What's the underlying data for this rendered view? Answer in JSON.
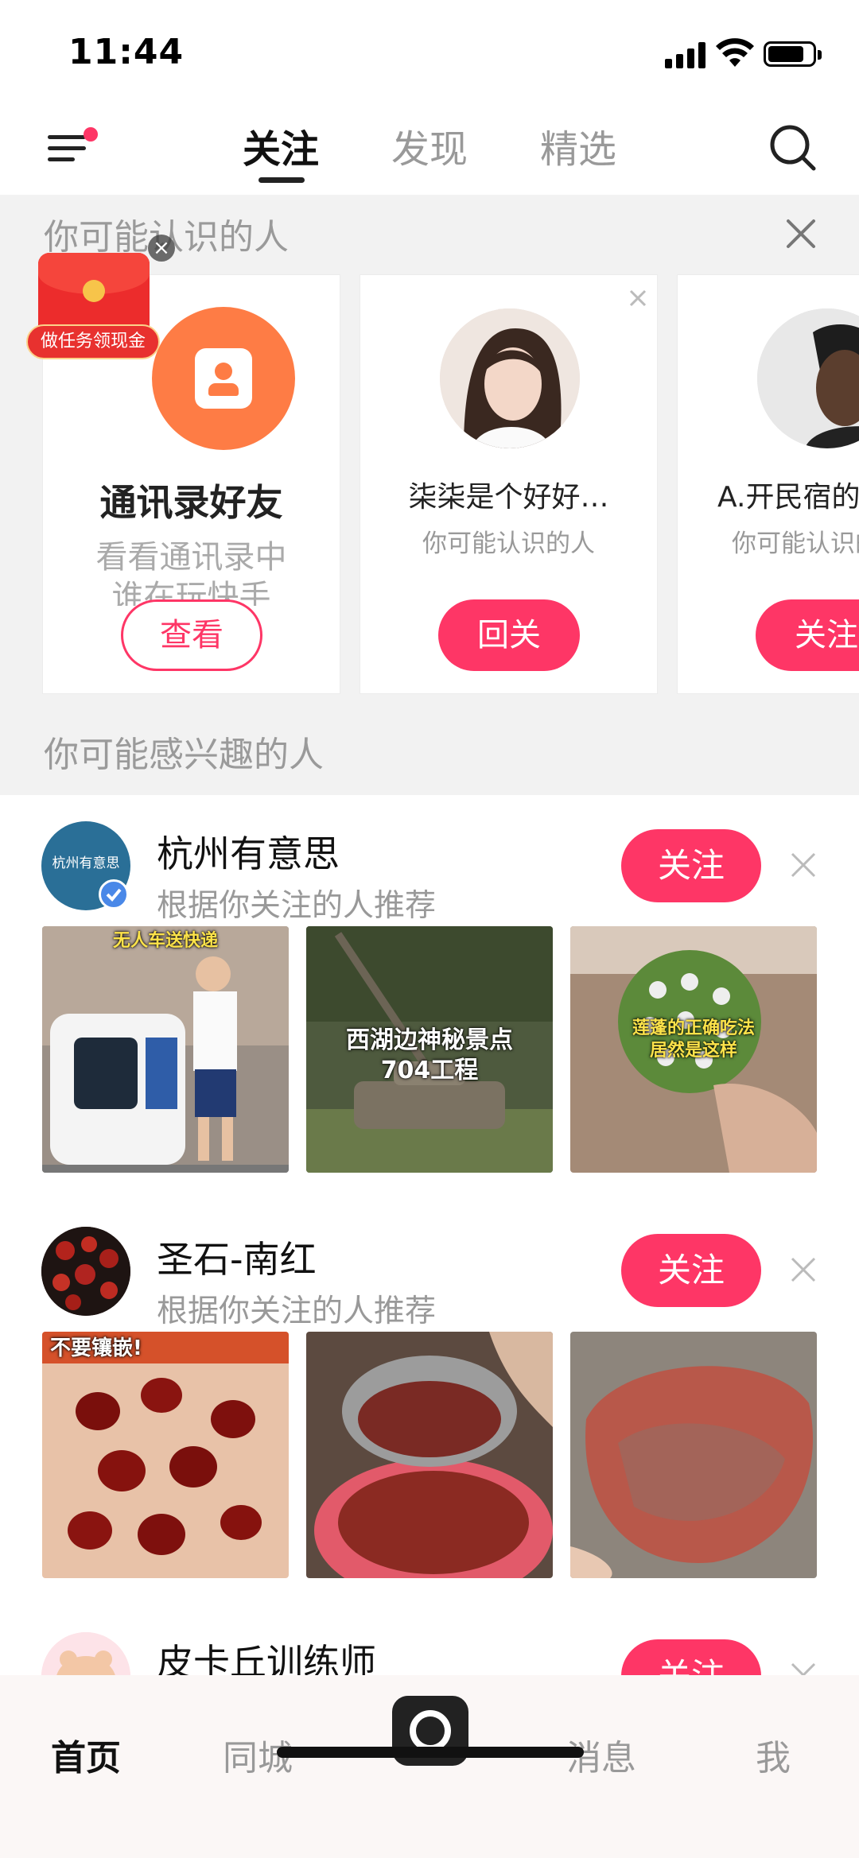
{
  "status_bar": {
    "time": "11:44"
  },
  "top_nav": {
    "tabs": [
      {
        "label": "关注",
        "active": true
      },
      {
        "label": "发现",
        "active": false
      },
      {
        "label": "精选",
        "active": false
      }
    ],
    "menu_icon": "menu-icon",
    "search_icon": "search-icon",
    "badge_color": "#fe3666"
  },
  "promo": {
    "label": "做任务领现金"
  },
  "people_you_may_know": {
    "title": "你可能认识的人",
    "cards": [
      {
        "name": "通讯录好友",
        "subtitle_line1": "看看通讯录中",
        "subtitle_line2": "谁在玩快手",
        "button": "查看",
        "icon": "contacts-icon"
      },
      {
        "name": "柒柒是个好好…",
        "subtitle": "你可能认识的人",
        "button": "回关"
      },
      {
        "name": "A.开民宿的",
        "subtitle": "你可能认识的人",
        "button": "关注"
      }
    ]
  },
  "interested": {
    "title": "你可能感兴趣的人",
    "items": [
      {
        "name": "杭州有意思",
        "subtitle": "根据你关注的人推荐",
        "avatar_text": "杭州有意思",
        "button": "关注",
        "thumbs": [
          {
            "caption": "无人车送快递"
          },
          {
            "caption_line1": "西湖边神秘景点",
            "caption_line2": "704工程"
          },
          {
            "caption_line1": "莲蓬的正确吃法",
            "caption_line2": "居然是这样"
          }
        ]
      },
      {
        "name": "圣石-南红",
        "subtitle": "根据你关注的人推荐",
        "button": "关注",
        "thumbs": [
          {
            "caption": "不要镶嵌!"
          },
          {
            "caption": ""
          },
          {
            "caption": ""
          }
        ]
      },
      {
        "name": "皮卡丘训练师",
        "button": "关注"
      }
    ]
  },
  "bottom_nav": {
    "items": [
      {
        "label": "首页",
        "active": true
      },
      {
        "label": "同城",
        "active": false
      },
      {
        "label": "消息",
        "active": false
      },
      {
        "label": "我",
        "active": false
      }
    ],
    "center_icon": "camera-icon"
  },
  "accent_color": "#fe3666"
}
